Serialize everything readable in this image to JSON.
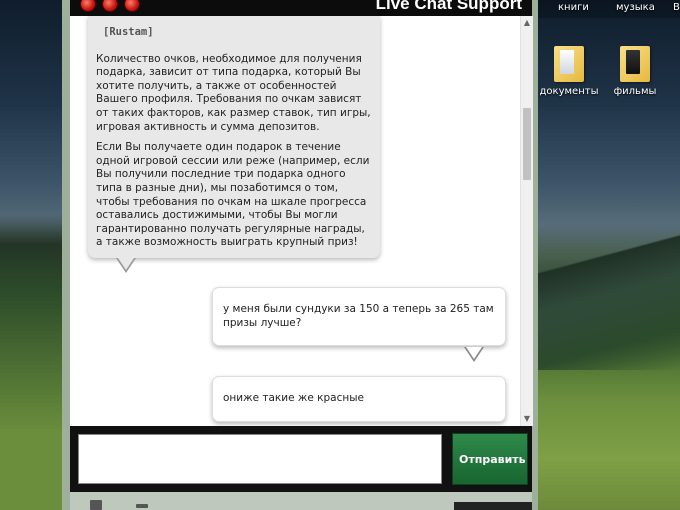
{
  "chat": {
    "title": "Live Chat Support",
    "agent_message": {
      "sender": "[Rustam]",
      "paragraphs": [
        "Количество очков, необходимое для получения подарка, зависит от типа подарка, который Вы хотите получить, а также от особенностей Вашего профиля. Требования по очкам зависят от таких факторов, как размер ставок, тип игры, игровая активность и сумма депозитов.",
        "Если Вы получаете один подарок в течение одной игровой сессии или реже (например, если Вы получили последние три подарка одного типа в разные дни), мы позаботимся о том, чтобы требования по очкам на шкале прогресса оставались достижимыми, чтобы Вы могли гарантированно получать регулярные награды, а также возможность выиграть крупный приз!"
      ]
    },
    "user_messages": [
      "у меня были сундуки за 150 а теперь за 265 там призы лучше?",
      "ониже такие же красные"
    ],
    "input_value": "",
    "send_label": "Отправить"
  },
  "desktop": {
    "top_labels": [
      "книги",
      "музыка",
      "В"
    ],
    "icons": [
      "документы",
      "фильмы"
    ]
  },
  "colors": {
    "send_button": "#1f7a3c",
    "agent_bubble": "#e8e8e8",
    "header": "#0c0c0c"
  }
}
